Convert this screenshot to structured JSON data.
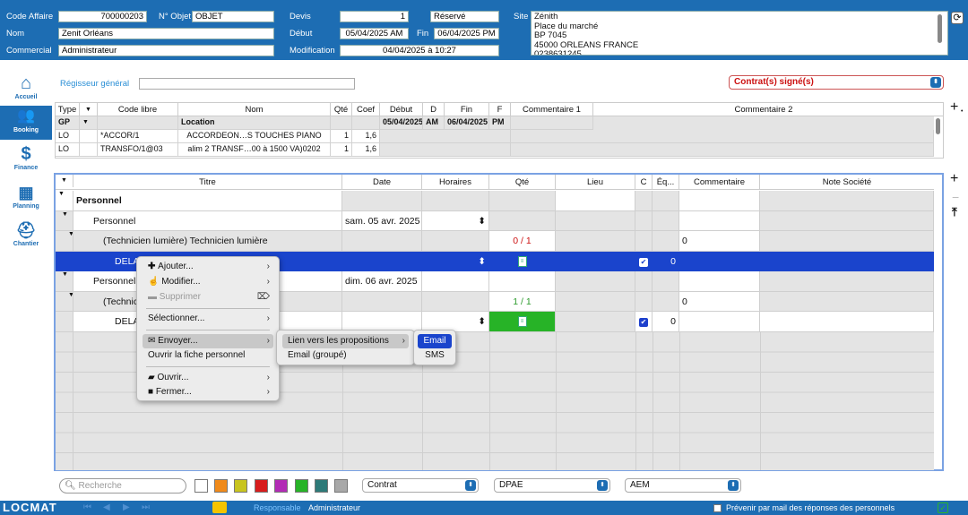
{
  "header": {
    "code_affaire_label": "Code Affaire",
    "code_affaire": "700000203",
    "objet_label": "N° Objet",
    "objet": "OBJET",
    "nom_label": "Nom",
    "nom": "Zenit Orléans",
    "commercial_label": "Commercial",
    "commercial": "Administrateur",
    "devis_label": "Devis",
    "devis": "1",
    "statut": "Réservé",
    "debut_label": "Début",
    "debut": "05/04/2025 AM",
    "fin_label": "Fin",
    "fin": "06/04/2025 PM",
    "modification_label": "Modification",
    "modification": "04/04/2025 à 10:27",
    "site_label": "Site",
    "site_lines": [
      "Zénith",
      "Place du marché",
      "BP 7045",
      "45000 ORLEANS FRANCE",
      "0238631245"
    ]
  },
  "sidebar": {
    "items": [
      {
        "label": "Accueil",
        "icon": "home-icon"
      },
      {
        "label": "Booking",
        "icon": "people-icon"
      },
      {
        "label": "Finance",
        "icon": "finance-icon"
      },
      {
        "label": "Planning",
        "icon": "calendar-icon"
      },
      {
        "label": "Chantier",
        "icon": "worker-icon"
      }
    ]
  },
  "regisseur": {
    "label": "Régisseur général",
    "value": ""
  },
  "contract_status": "Contrat(s) signé(s)",
  "top_table": {
    "headers": [
      "Type",
      "▼",
      "Code libre",
      "Nom",
      "Qté",
      "Coef",
      "Début",
      "D",
      "Fin",
      "F",
      "Commentaire 1",
      "Commentaire 2"
    ],
    "group_row": [
      "GP",
      "▼",
      "",
      "Location",
      "",
      "",
      "05/04/2025",
      "AM",
      "06/04/2025",
      "PM",
      "",
      ""
    ],
    "rows": [
      [
        "LO",
        "",
        "*ACCOR/1",
        "ACCORDEON…S TOUCHES PIANO",
        "1",
        "1,6",
        "",
        "",
        "",
        "",
        "",
        ""
      ],
      [
        "LO",
        "",
        "TRANSFO/1@03",
        "alim  2 TRANSF…00 à 1500 VA)0202",
        "1",
        "1,6",
        "",
        "",
        "",
        "",
        "",
        ""
      ]
    ]
  },
  "main_table": {
    "headers": [
      "▼",
      "Titre",
      "Date",
      "Horaires",
      "Qté",
      "Lieu",
      "C",
      "Éq...",
      "Commentaire",
      "Note Société"
    ],
    "rows": [
      {
        "titre": "Personnel",
        "date": "",
        "qte": "",
        "eq": "",
        "comment": ""
      },
      {
        "titre": "Personnel",
        "date": "sam. 05 avr. 2025",
        "qte": "",
        "eq": "",
        "comment": ""
      },
      {
        "titre": "(Technicien lumière) Technicien lumière",
        "date": "",
        "qte": "0 / 1",
        "eq": "",
        "comment": "0"
      },
      {
        "titre": "DELA",
        "date": "",
        "qte": "",
        "eq": "0",
        "comment": ""
      },
      {
        "titre": "Personnel",
        "date": "dim. 06 avr. 2025",
        "qte": "",
        "eq": "",
        "comment": ""
      },
      {
        "titre": "(Technic",
        "date": "",
        "qte": "1 / 1",
        "eq": "",
        "comment": "0"
      },
      {
        "titre": "DELA",
        "date": "",
        "qte": "",
        "eq": "0",
        "comment": ""
      }
    ]
  },
  "context_menu": {
    "items": [
      "Ajouter...",
      "Modifier...",
      "Supprimer",
      "Sélectionner...",
      "Envoyer...",
      "Ouvrir la fiche personnel",
      "Ouvrir...",
      "Fermer..."
    ]
  },
  "submenu": {
    "items": [
      "Lien vers les propositions",
      "Email (groupé)"
    ]
  },
  "submenu2": {
    "items": [
      "Email",
      "SMS"
    ]
  },
  "bottom": {
    "search_placeholder": "Recherche",
    "swatches": [
      "#ffffff",
      "#f08a1a",
      "#c8c41e",
      "#d81c1c",
      "#b22bb5",
      "#27b327",
      "#2d7a78",
      "#a8a8a8"
    ],
    "select1": "Contrat",
    "select2": "DPAE",
    "select3": "AEM"
  },
  "footer": {
    "logo": "LOCMAT",
    "responsable_label": "Responsable",
    "responsable": "Administrateur",
    "prevenir": "Prévenir par mail des réponses des personnels"
  },
  "colors": {
    "brand": "#1d6db3",
    "selected_row": "#1a44cc",
    "status_red": "#cc1111",
    "ok_green": "#2a9a2a"
  }
}
